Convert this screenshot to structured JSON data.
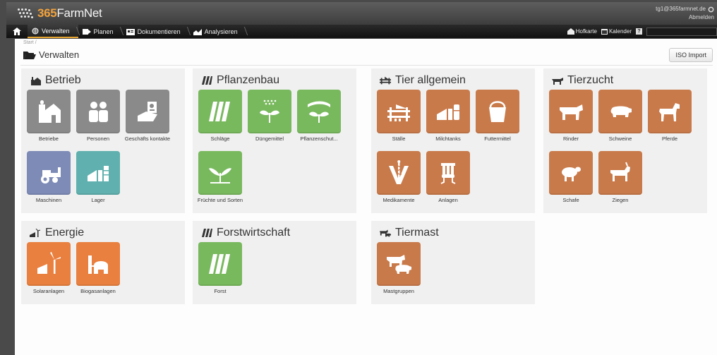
{
  "app": {
    "logo_num": "365",
    "logo_name": "FarmNet"
  },
  "user": {
    "email": "tg1@365farmnet.de",
    "logout": "Abmelden"
  },
  "nav": {
    "home_icon": "home-icon",
    "items": [
      {
        "label": "Verwalten",
        "icon": "globe-icon",
        "active": true
      },
      {
        "label": "Planen",
        "icon": "planning-icon",
        "active": false
      },
      {
        "label": "Dokumentieren",
        "icon": "document-icon",
        "active": false
      },
      {
        "label": "Analysieren",
        "icon": "chart-icon",
        "active": false
      }
    ],
    "hofkarte": "Hofkarte",
    "kalender": "Kalender",
    "help": "?"
  },
  "page": {
    "breadcrumb": "Start /",
    "title": "Verwalten",
    "iso_import": "ISO Import"
  },
  "panels": {
    "betrieb": {
      "title": "Betrieb",
      "tiles": [
        "Betriebe",
        "Personen",
        "Geschäfts kontakte",
        "Maschinen",
        "Lager"
      ]
    },
    "pflanzenbau": {
      "title": "Pflanzenbau",
      "tiles": [
        "Schläge",
        "Düngemittel",
        "Pflanzenschut...",
        "Früchte und Sorten"
      ]
    },
    "tier_allgemein": {
      "title": "Tier allgemein",
      "tiles": [
        "Ställe",
        "Milchtanks",
        "Futtermittel",
        "Medikamente",
        "Anlagen"
      ]
    },
    "tierzucht": {
      "title": "Tierzucht",
      "tiles": [
        "Rinder",
        "Schweine",
        "Pferde",
        "Schafe",
        "Ziegen"
      ]
    },
    "energie": {
      "title": "Energie",
      "tiles": [
        "Solaranlagen",
        "Biogasanlagen"
      ]
    },
    "forstwirtschaft": {
      "title": "Forstwirtschaft",
      "tiles": [
        "Forst"
      ]
    },
    "tiermast": {
      "title": "Tiermast",
      "tiles": [
        "Mastgruppen"
      ]
    }
  },
  "colors": {
    "gray": "#8a8a8a",
    "blue": "#7d8bb6",
    "teal": "#5fb0ae",
    "green": "#79b95e",
    "brown": "#c97a4a",
    "orange": "#e9803f",
    "accent": "#e6a531"
  }
}
